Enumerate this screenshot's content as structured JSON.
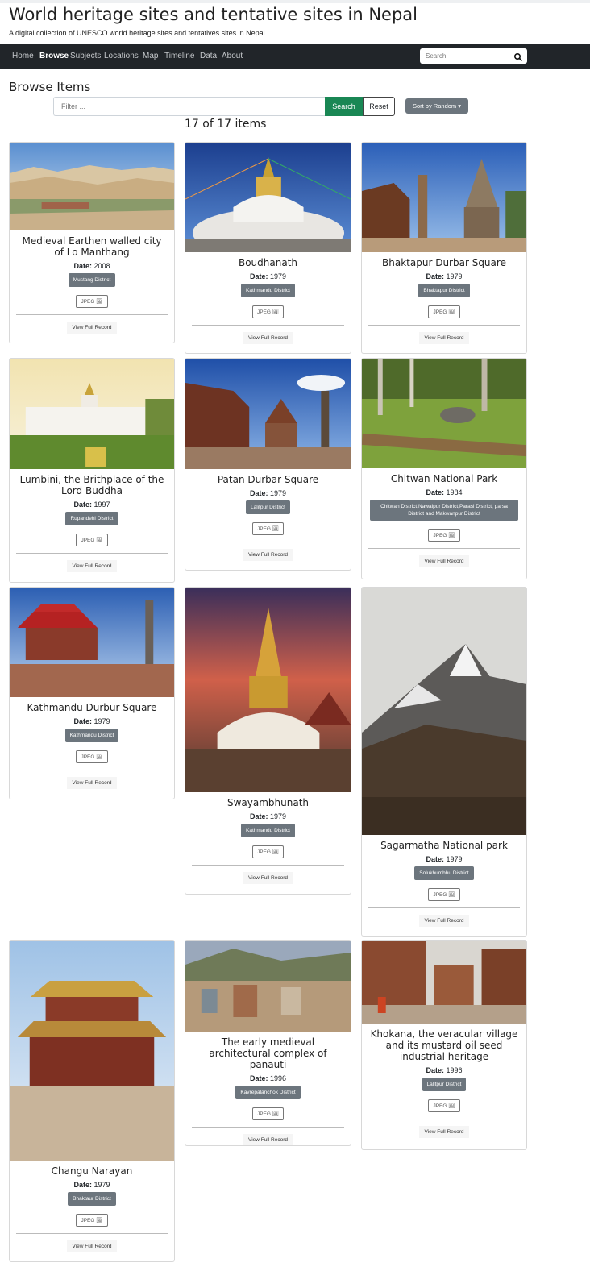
{
  "header": {
    "title": "World heritage sites and tentative sites in Nepal",
    "subtitle": "A digital collection of UNESCO world heritage sites and tentatives sites in Nepal"
  },
  "nav": {
    "items": [
      "Home",
      "Browse",
      "Subjects",
      "Locations",
      "Map",
      "Timeline",
      "Data",
      "About"
    ],
    "active": "Browse",
    "search_placeholder": "Search",
    "search_icon": "search-icon"
  },
  "browse": {
    "heading": "Browse Items",
    "filter_placeholder": "Filter ...",
    "search_label": "Search",
    "reset_label": "Reset",
    "sort_label": "Sort by Random",
    "count": "17 of 17 items"
  },
  "colors": {
    "navbar": "#212529",
    "search_button": "#198754",
    "badge": "#6c757d"
  },
  "items": [
    {
      "title": "Medieval Earthen walled city of Lo Manthang",
      "date_label": "Date:",
      "date": "2008",
      "location": "Mustang District",
      "format": "JPEG",
      "link": "View Full Record"
    },
    {
      "title": "Boudhanath",
      "date_label": "Date:",
      "date": "1979",
      "location": "Kathmandu District",
      "format": "JPEG",
      "link": "View Full Record"
    },
    {
      "title": "Bhaktapur Durbar Square",
      "date_label": "Date:",
      "date": "1979",
      "location": "Bhaktapur District",
      "format": "JPEG",
      "link": "View Full Record"
    },
    {
      "title": "Lumbini, the Brithplace of the Lord Buddha",
      "date_label": "Date:",
      "date": "1997",
      "location": "Rupandehi District",
      "format": "JPEG",
      "link": "View Full Record"
    },
    {
      "title": "Patan Durbar Square",
      "date_label": "Date:",
      "date": "1979",
      "location": "Lalitpur District",
      "format": "JPEG",
      "link": "View Full Record"
    },
    {
      "title": "Chitwan National Park",
      "date_label": "Date:",
      "date": "1984",
      "location": "Chitwan District,Nawalpur District,Parasi District, parsa District and Makwanpur District",
      "format": "JPEG",
      "link": "View Full Record"
    },
    {
      "title": "Kathmandu Durbur Square",
      "date_label": "Date:",
      "date": "1979",
      "location": "Kathmandu District",
      "format": "JPEG",
      "link": "View Full Record"
    },
    {
      "title": "Swayambhunath",
      "date_label": "Date:",
      "date": "1979",
      "location": "Kathmandu District",
      "format": "JPEG",
      "link": "View Full Record"
    },
    {
      "title": "Sagarmatha National park",
      "date_label": "Date:",
      "date": "1979",
      "location": "Solukhumbhu District",
      "format": "JPEG",
      "link": "View Full Record"
    },
    {
      "title": "Changu Narayan",
      "date_label": "Date:",
      "date": "1979",
      "location": "Bhaktaur District",
      "format": "JPEG",
      "link": "View Full Record"
    },
    {
      "title": "The early medieval architectural complex of panauti",
      "date_label": "Date:",
      "date": "1996",
      "location": "Kavrepalanchok District",
      "format": "JPEG",
      "link": "View Full Record"
    },
    {
      "title": "Khokana, the veracular village and its mustard oil seed industrial heritage",
      "date_label": "Date:",
      "date": "1996",
      "location": "Lalitpur District",
      "format": "JPEG",
      "link": "View Full Record"
    }
  ]
}
